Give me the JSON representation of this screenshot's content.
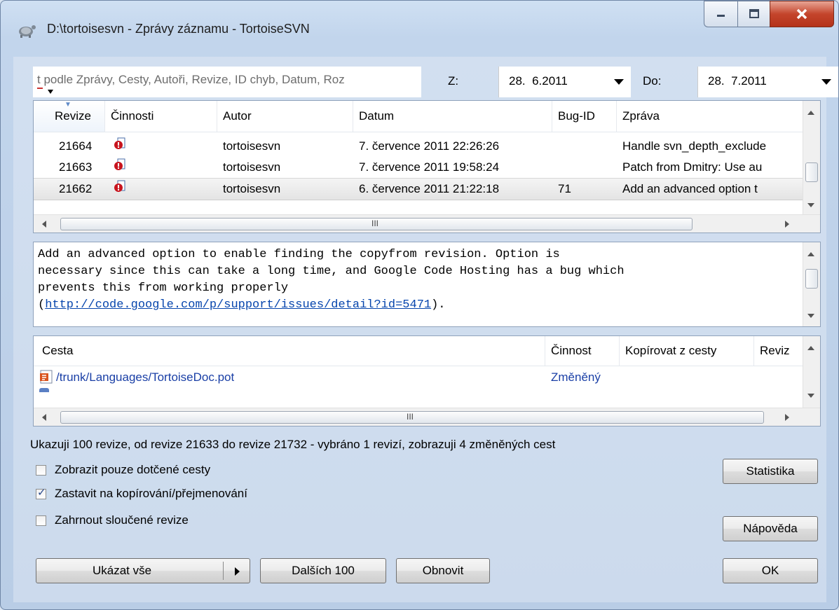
{
  "window": {
    "title": "D:\\tortoisesvn - Zprávy záznamu - TortoiseSVN",
    "controls": {
      "minimize": "–",
      "maximize": "□",
      "close": "X"
    }
  },
  "filter": {
    "search_placeholder": "t podle Zprávy, Cesty, Autoři, Revize, ID chyb, Datum, Roz",
    "from_label": "Z:",
    "from_date": "28.  6.2011",
    "to_label": "Do:",
    "to_date": "28.  7.2011"
  },
  "log_list": {
    "columns": [
      "Revize",
      "Činnosti",
      "Autor",
      "Datum",
      "Bug-ID",
      "Zpráva"
    ],
    "rows": [
      {
        "revision": "21664",
        "author": "tortoisesvn",
        "date": "7. července 2011 22:26:26",
        "bug_id": "",
        "message": "Handle svn_depth_exclude"
      },
      {
        "revision": "21663",
        "author": "tortoisesvn",
        "date": "7. července 2011 19:58:24",
        "bug_id": "",
        "message": "Patch from Dmitry: Use au"
      },
      {
        "revision": "21662",
        "author": "tortoisesvn",
        "date": "6. července 2011 21:22:18",
        "bug_id": "71",
        "message": "Add an advanced option t",
        "selected": true
      }
    ],
    "scroll_grip": "III"
  },
  "message_pane": {
    "line1": "Add an advanced option to enable finding the copyfrom revision. Option is",
    "line2": "necessary since this can take a long time, and Google Code Hosting has a bug which",
    "line3": "prevents this from working properly",
    "line4_prefix": "(",
    "link": "http://code.google.com/p/support/issues/detail?id=5471",
    "line4_suffix": ")."
  },
  "paths_list": {
    "columns": [
      "Cesta",
      "Činnost",
      "Kopírovat z cesty",
      "Reviz"
    ],
    "rows": [
      {
        "path": "/trunk/Languages/TortoiseDoc.pot",
        "action": "Změněný"
      }
    ],
    "scroll_grip": "III"
  },
  "status": "Ukazuji 100 revize, od revize 21633 do revize 21732 - vybráno 1 revizí, zobrazuji 4 změněných cest",
  "options": {
    "only_affected": {
      "label": "Zobrazit pouze dotčené cesty",
      "checked": false
    },
    "stop_on_copy": {
      "label": "Zastavit na kopírování/přejmenování",
      "checked": true
    },
    "include_merged": {
      "label": "Zahrnout sloučené revize",
      "checked": false
    }
  },
  "buttons": {
    "statistics": "Statistika",
    "help": "Nápověda",
    "show_all": "Ukázat vše",
    "next_100": "Dalších 100",
    "refresh": "Obnovit",
    "ok": "OK"
  }
}
